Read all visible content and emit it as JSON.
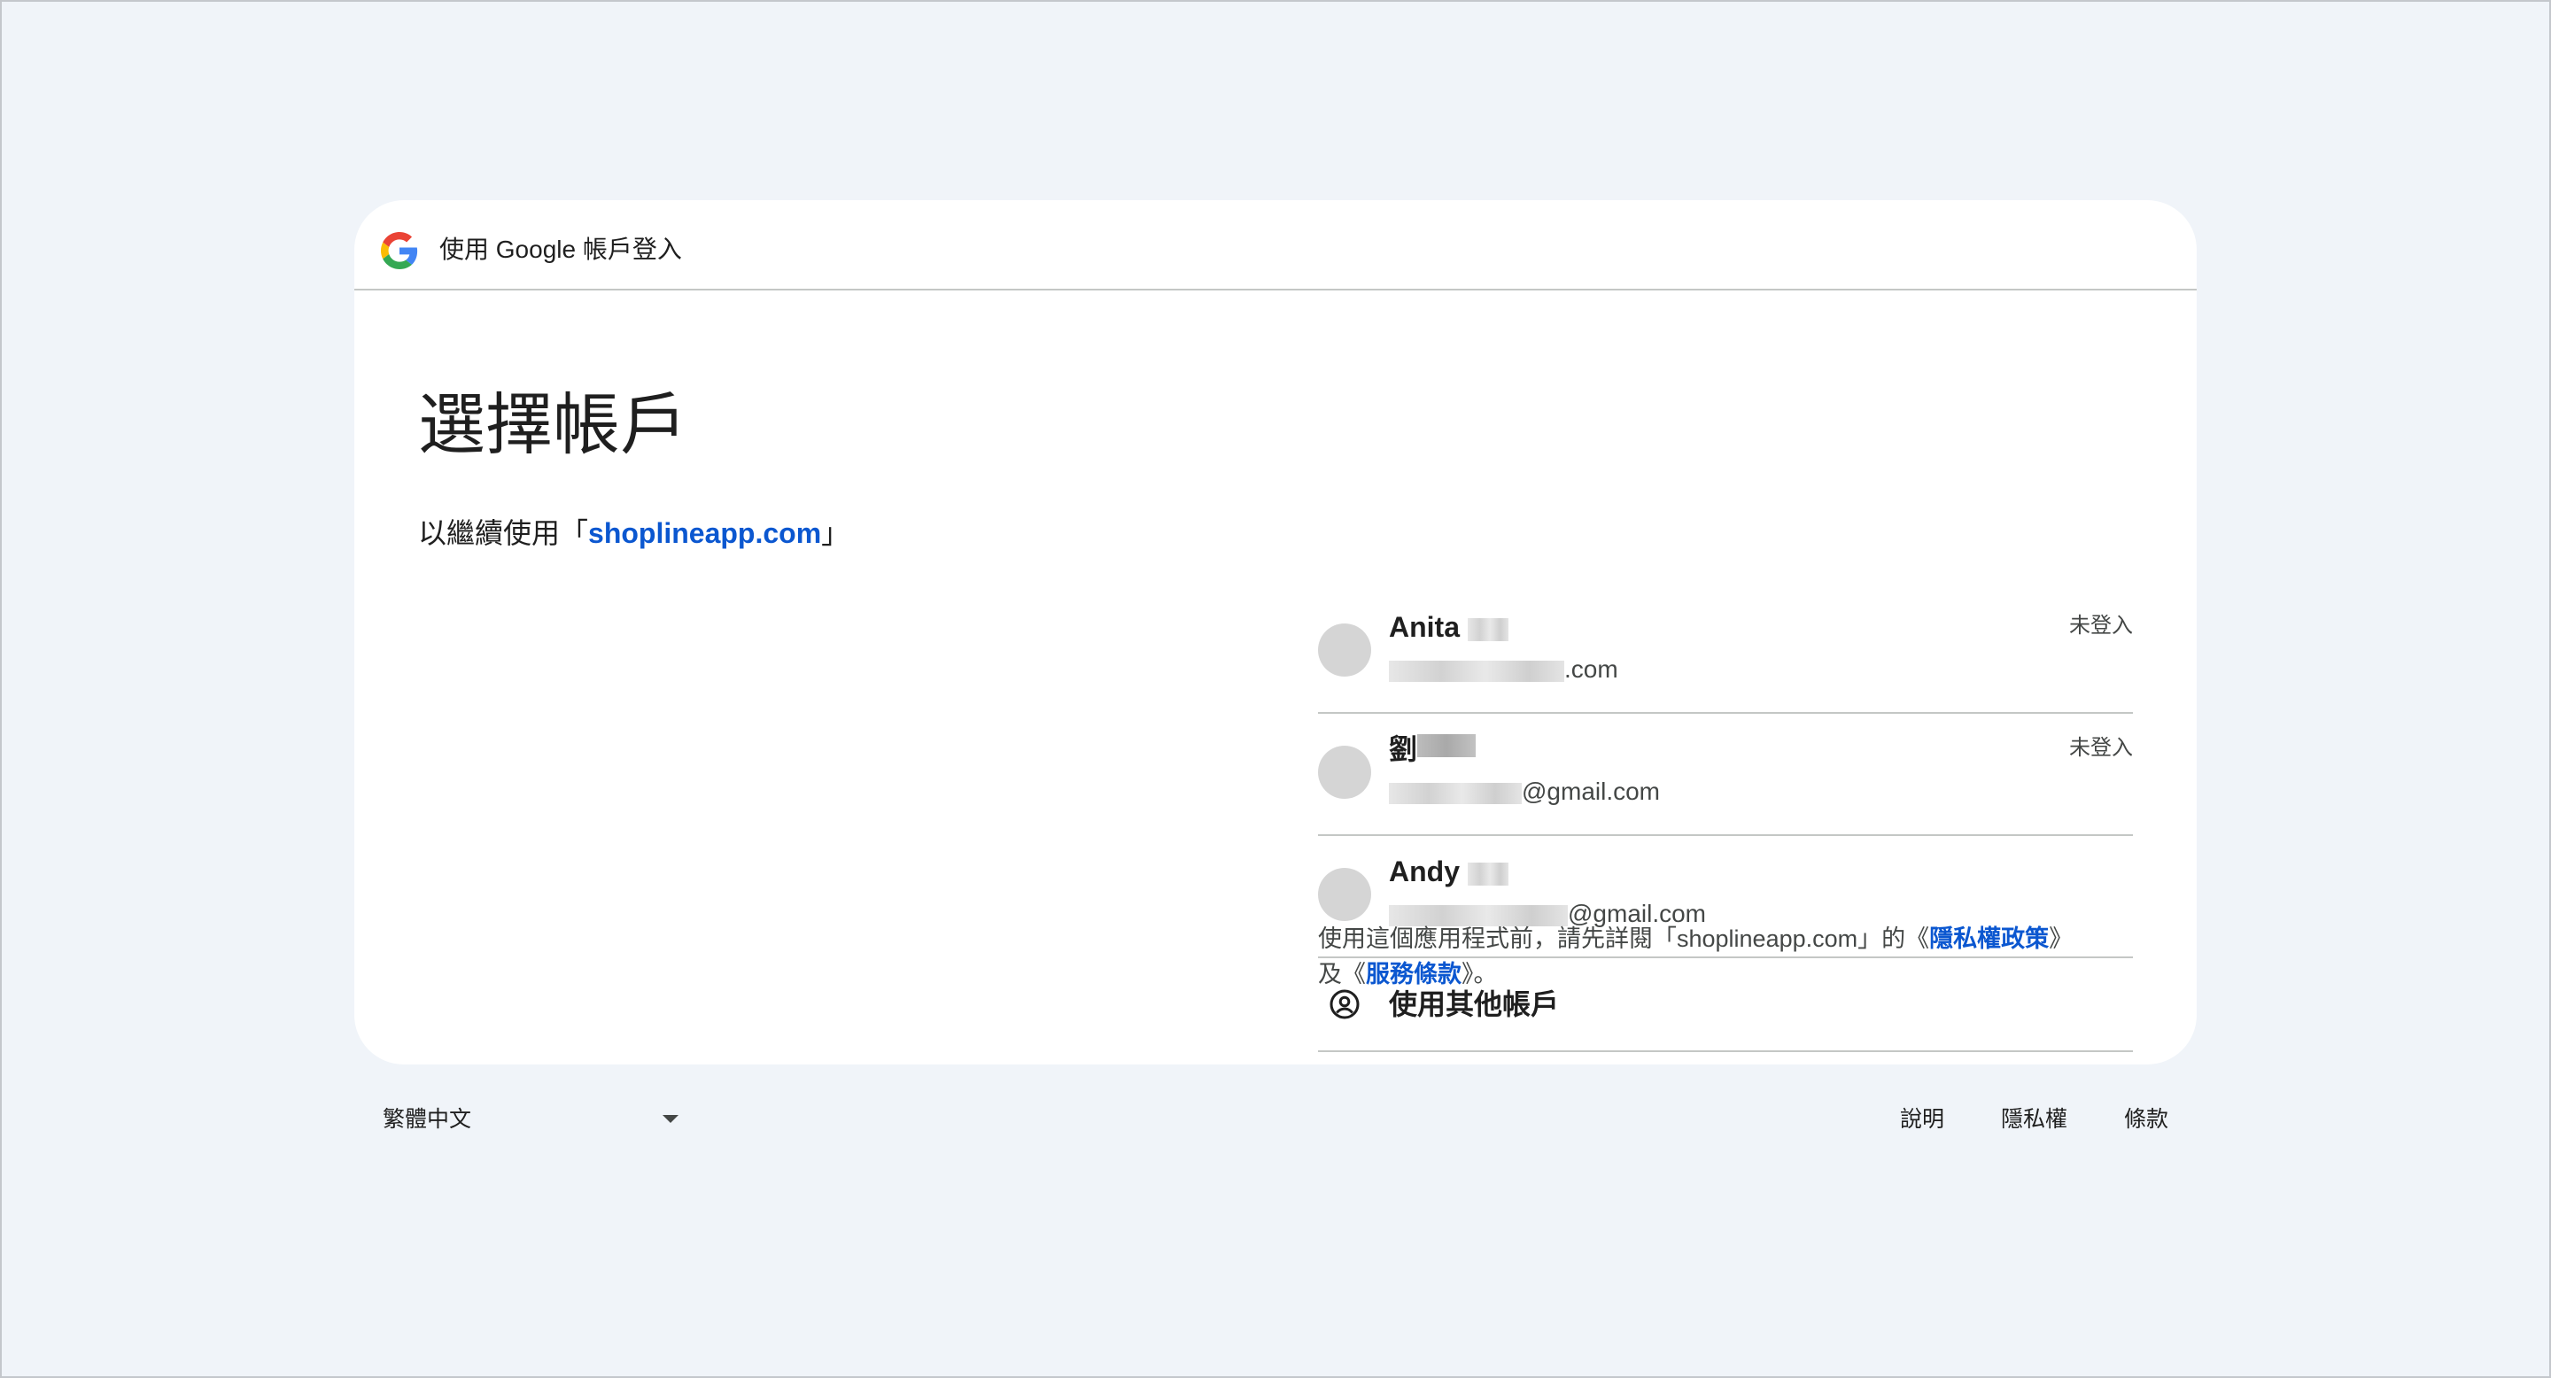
{
  "header": {
    "title": "使用 Google 帳戶登入",
    "logo_icon": "google-g-logo"
  },
  "main": {
    "title": "選擇帳戶",
    "subtitle_prefix": "以繼續使用「",
    "app_name": "shoplineapp.com",
    "subtitle_suffix": "」"
  },
  "accounts": [
    {
      "name": "Anita",
      "email_suffix": ".com",
      "status": "未登入"
    },
    {
      "name": "劉",
      "email_suffix": "@gmail.com",
      "status": "未登入"
    },
    {
      "name": "Andy",
      "email_suffix": "@gmail.com",
      "status": ""
    }
  ],
  "other_account": {
    "label": "使用其他帳戶",
    "icon": "account-circle-icon"
  },
  "disclaimer": {
    "line1_prefix": "使用這個應用程式前，請先詳閱「shoplineapp.com」的《",
    "privacy_label": "隱私權政策",
    "line1_suffix": "》",
    "line2_prefix": "及《",
    "terms_label": "服務條款",
    "line2_suffix": "》。"
  },
  "footer": {
    "language": "繁體中文",
    "links": {
      "help": "說明",
      "privacy": "隱私權",
      "terms": "條款"
    }
  },
  "colors": {
    "page_background": "#f0f4f9",
    "card_background": "#ffffff",
    "link_blue": "#0b57d0",
    "divider": "#c4c7c5",
    "avatar_placeholder": "#d5d5d5"
  }
}
